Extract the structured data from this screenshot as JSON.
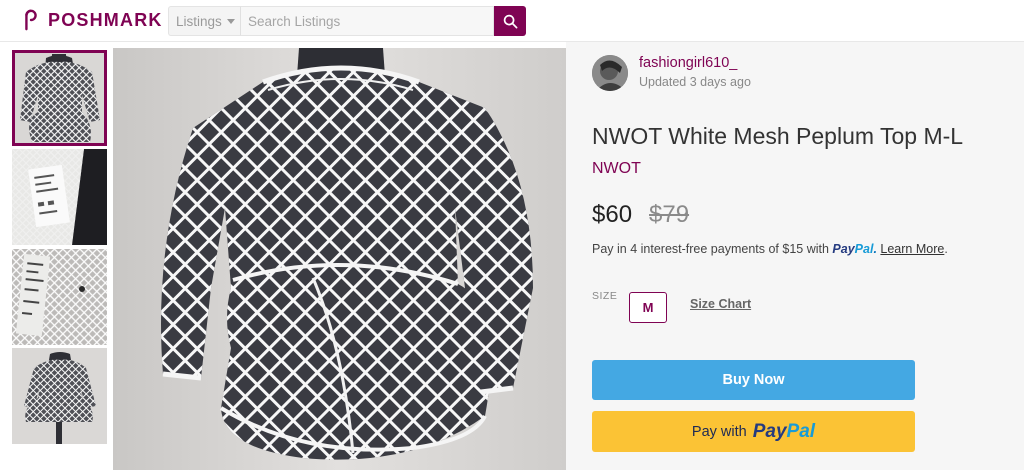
{
  "header": {
    "brand": "POSHMARK",
    "category_select": "Listings",
    "search_placeholder": "Search Listings"
  },
  "gallery": {
    "thumbnails": [
      {
        "name": "front-view",
        "selected": true
      },
      {
        "name": "tag-view",
        "selected": false
      },
      {
        "name": "label-view",
        "selected": false
      },
      {
        "name": "side-view",
        "selected": false
      }
    ]
  },
  "seller": {
    "username": "fashiongirl610_",
    "updated": "Updated 3 days ago"
  },
  "listing": {
    "title": "NWOT White Mesh Peplum Top M-L",
    "condition": "NWOT",
    "price": "$60",
    "original_price": "$79",
    "installments_text": "Pay in 4 interest-free payments of $15 with",
    "installments_paypal_1": "Pay",
    "installments_paypal_2": "Pal",
    "installments_period": ".",
    "learn_more": "Learn More",
    "size_label": "SIZE",
    "size_value": "M",
    "size_chart": "Size Chart"
  },
  "actions": {
    "buy_now": "Buy Now",
    "pay_with": "Pay with",
    "paypal_1": "Pay",
    "paypal_2": "Pal"
  },
  "colors": {
    "brand": "#7f0353",
    "buy_now": "#44a8e3",
    "paypal_button": "#fbc335",
    "paypal_dark": "#253b80",
    "paypal_light": "#179bd7"
  }
}
